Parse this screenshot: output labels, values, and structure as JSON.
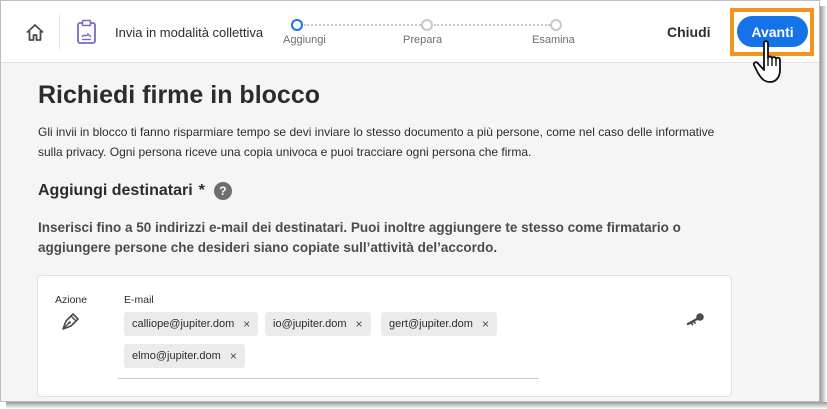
{
  "header": {
    "mode_title": "Invia in modalità collettiva",
    "steps": [
      {
        "label": "Aggiungi",
        "state": "active"
      },
      {
        "label": "Prepara",
        "state": "inactive"
      },
      {
        "label": "Esamina",
        "state": "inactive"
      }
    ],
    "close_label": "Chiudi",
    "next_label": "Avanti",
    "icons": {
      "home": "home-icon",
      "mode": "clipboard-icon"
    }
  },
  "main": {
    "title": "Richiedi firme in blocco",
    "intro": "Gli invii in blocco ti fanno risparmiare tempo se devi inviare lo stesso documento a più persone, come nel caso delle informative sulla privacy. Ogni persona riceve una copia univoca e puoi tracciare ogni persona che firma.",
    "recipients_title": "Aggiungi destinatari",
    "required_mark": "*",
    "help_glyph": "?",
    "hint": "Inserisci fino a 50 indirizzi e-mail dei destinatari. Puoi inoltre aggiungere te stesso come firmatario o aggiungere persone che desideri siano copiate sull’attività del’accordo."
  },
  "recipient_card": {
    "action_label": "Azione",
    "email_label": "E-mail",
    "action_icon": "pen-icon",
    "auth_icon": "key-icon",
    "remove_glyph": "×",
    "emails": [
      "calliope@jupiter.dom",
      "io@jupiter.dom",
      "gert@jupiter.dom",
      "elmo@jupiter.dom"
    ]
  },
  "colors": {
    "accent": "#1473e6",
    "highlight": "#f39420",
    "text": "#2c2c2c",
    "chip_bg": "#ebebeb"
  }
}
